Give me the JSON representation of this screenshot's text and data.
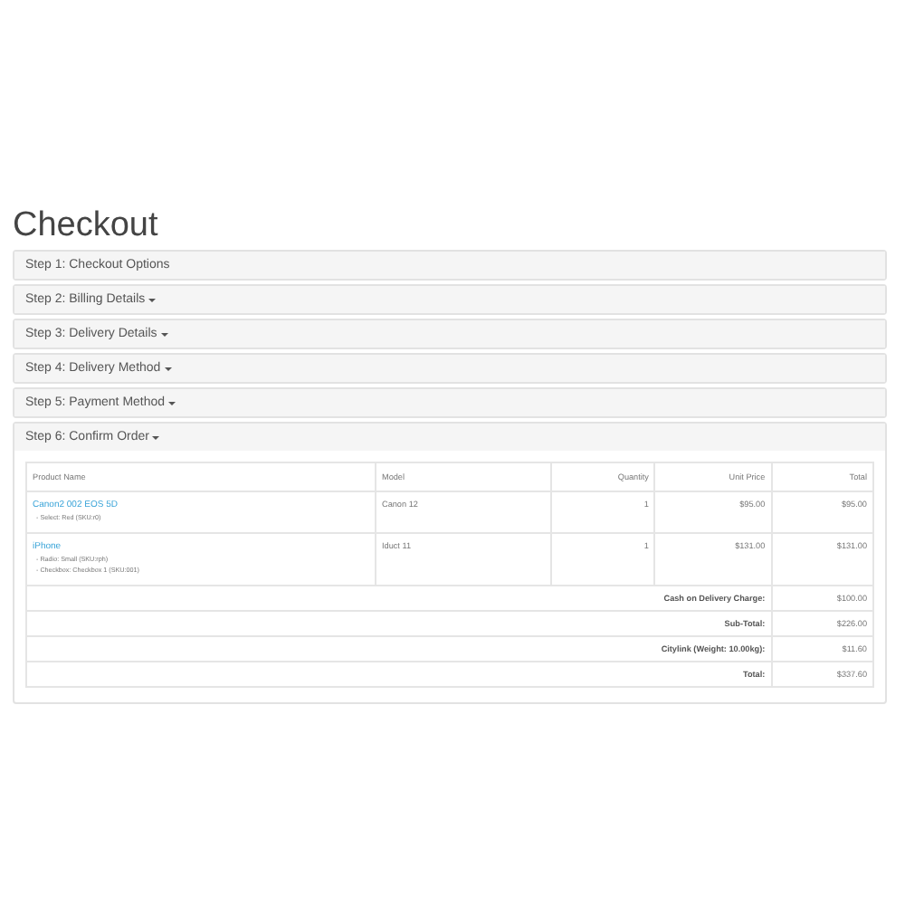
{
  "title": "Checkout",
  "steps": [
    {
      "label": "Step 1: Checkout Options",
      "dropdown": false
    },
    {
      "label": "Step 2: Billing Details",
      "dropdown": true
    },
    {
      "label": "Step 3: Delivery Details",
      "dropdown": true
    },
    {
      "label": "Step 4: Delivery Method",
      "dropdown": true
    },
    {
      "label": "Step 5: Payment Method",
      "dropdown": true
    },
    {
      "label": "Step 6: Confirm Order",
      "dropdown": true
    }
  ],
  "table": {
    "columns": [
      "Product Name",
      "Model",
      "Quantity",
      "Unit Price",
      "Total"
    ],
    "rows": [
      {
        "product": "Canon2 002 EOS 5D",
        "options": [
          "- Select: Red (SKU:r0)"
        ],
        "model": "Canon 12",
        "quantity": "1",
        "unit_price": "$95.00",
        "total": "$95.00"
      },
      {
        "product": "iPhone",
        "options": [
          "- Radio: Small (SKU:rph)",
          "- Checkbox: Checkbox 1 (SKU:001)"
        ],
        "model": "Iduct 11",
        "quantity": "1",
        "unit_price": "$131.00",
        "total": "$131.00"
      }
    ],
    "totals": [
      {
        "label": "Cash on Delivery Charge:",
        "value": "$100.00"
      },
      {
        "label": "Sub-Total:",
        "value": "$226.00"
      },
      {
        "label": "Citylink (Weight: 10.00kg):",
        "value": "$11.60"
      },
      {
        "label": "Total:",
        "value": "$337.60"
      }
    ]
  }
}
